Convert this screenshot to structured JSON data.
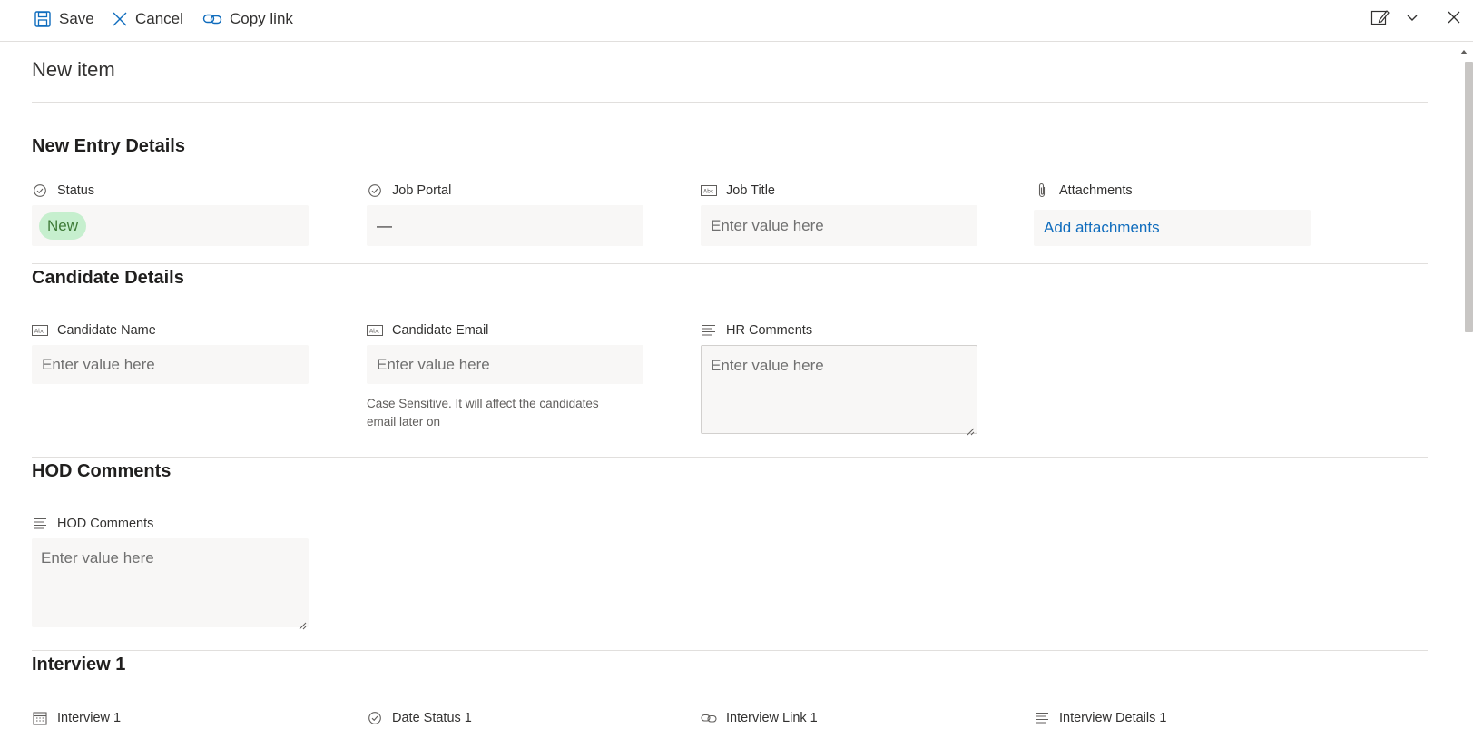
{
  "toolbar": {
    "save_label": "Save",
    "cancel_label": "Cancel",
    "copy_link_label": "Copy link"
  },
  "page": {
    "title": "New item"
  },
  "sections": {
    "entry": {
      "title": "New Entry Details",
      "status_label": "Status",
      "status_value": "New",
      "job_portal_label": "Job Portal",
      "job_portal_value": "—",
      "job_title_label": "Job Title",
      "job_title_placeholder": "Enter value here",
      "attachments_label": "Attachments",
      "attachments_link": "Add attachments"
    },
    "candidate": {
      "title": "Candidate Details",
      "name_label": "Candidate Name",
      "name_placeholder": "Enter value here",
      "email_label": "Candidate Email",
      "email_placeholder": "Enter value here",
      "email_hint": "Case Sensitive. It will affect the candidates email later on",
      "hr_label": "HR Comments",
      "hr_placeholder": "Enter value here"
    },
    "hod": {
      "title": "HOD Comments",
      "hod_label": "HOD Comments",
      "hod_placeholder": "Enter value here"
    },
    "interview1": {
      "title": "Interview 1",
      "date_label": "Interview 1",
      "date_status_label": "Date Status 1",
      "link_label": "Interview Link 1",
      "details_label": "Interview Details 1"
    }
  },
  "colors": {
    "accent": "#0f6cbd",
    "status_new_bg": "#c6efce",
    "status_new_text": "#3e7b37",
    "field_bg": "#f8f7f6"
  }
}
